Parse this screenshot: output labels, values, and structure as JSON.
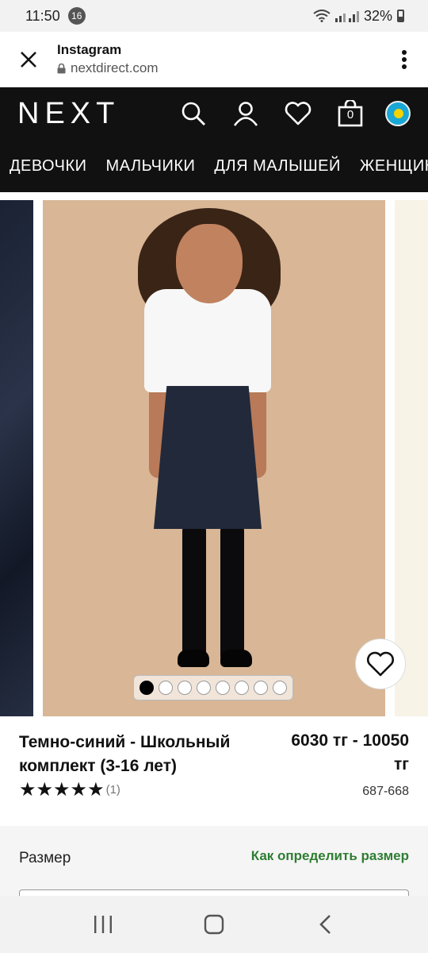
{
  "status": {
    "time": "11:50",
    "notification_count": "16",
    "battery": "32%"
  },
  "browser": {
    "title": "Instagram",
    "domain": "nextdirect.com"
  },
  "site": {
    "logo": "NEXT",
    "bag_count": "0"
  },
  "categories": [
    "ДЕВОЧКИ",
    "МАЛЬЧИКИ",
    "ДЛЯ МАЛЫШЕЙ",
    "ЖЕНЩИНЫ"
  ],
  "gallery": {
    "image_count": 8,
    "active_index": 0
  },
  "product": {
    "name": "Темно-синий - Школьный комплект (3-16 лет)",
    "price": "6030 тг - 10050 тг",
    "rating_stars": 5,
    "rating_count": "(1)",
    "code": "687-668"
  },
  "size": {
    "label": "Размер",
    "guide_link": "Как определить размер"
  },
  "colors": {
    "header_bg": "#111111",
    "link_green": "#2e7d32",
    "image_bg": "#d8b696"
  }
}
